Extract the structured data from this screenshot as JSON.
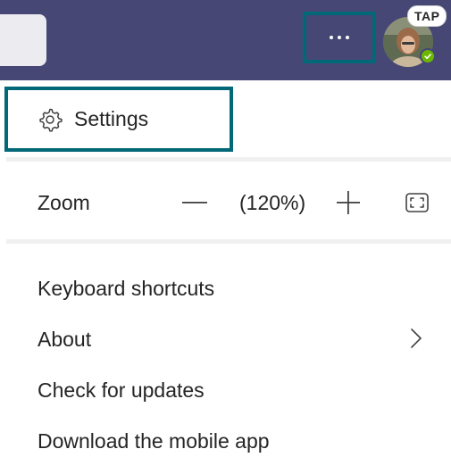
{
  "header": {
    "more_label": "...",
    "badge": "TAP",
    "colors": {
      "bar": "#464775",
      "highlight": "#006877",
      "presence": "#6bb700"
    }
  },
  "menu": {
    "settings": {
      "label": "Settings",
      "icon": "gear-icon"
    },
    "zoom": {
      "label": "Zoom",
      "value": "(120%)",
      "decrease_icon": "minus-icon",
      "increase_icon": "plus-icon",
      "fullscreen_icon": "fullscreen-icon"
    },
    "items": [
      {
        "label": "Keyboard shortcuts"
      },
      {
        "label": "About",
        "icon": "chevron-right-icon"
      },
      {
        "label": "Check for updates"
      },
      {
        "label": "Download the mobile app"
      }
    ]
  }
}
